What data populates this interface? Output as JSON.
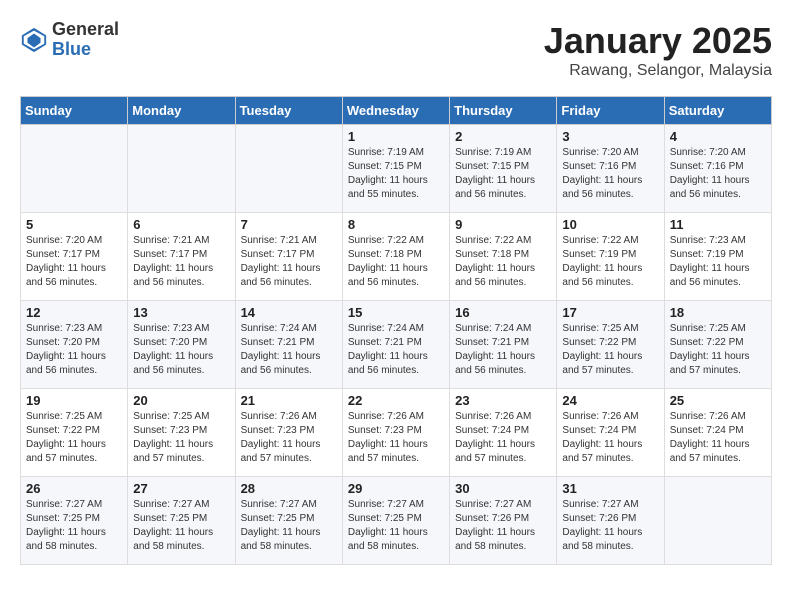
{
  "logo": {
    "general": "General",
    "blue": "Blue"
  },
  "header": {
    "month": "January 2025",
    "location": "Rawang, Selangor, Malaysia"
  },
  "weekdays": [
    "Sunday",
    "Monday",
    "Tuesday",
    "Wednesday",
    "Thursday",
    "Friday",
    "Saturday"
  ],
  "weeks": [
    [
      {
        "day": "",
        "sunrise": "",
        "sunset": "",
        "daylight": ""
      },
      {
        "day": "",
        "sunrise": "",
        "sunset": "",
        "daylight": ""
      },
      {
        "day": "",
        "sunrise": "",
        "sunset": "",
        "daylight": ""
      },
      {
        "day": "1",
        "sunrise": "Sunrise: 7:19 AM",
        "sunset": "Sunset: 7:15 PM",
        "daylight": "Daylight: 11 hours and 55 minutes."
      },
      {
        "day": "2",
        "sunrise": "Sunrise: 7:19 AM",
        "sunset": "Sunset: 7:15 PM",
        "daylight": "Daylight: 11 hours and 56 minutes."
      },
      {
        "day": "3",
        "sunrise": "Sunrise: 7:20 AM",
        "sunset": "Sunset: 7:16 PM",
        "daylight": "Daylight: 11 hours and 56 minutes."
      },
      {
        "day": "4",
        "sunrise": "Sunrise: 7:20 AM",
        "sunset": "Sunset: 7:16 PM",
        "daylight": "Daylight: 11 hours and 56 minutes."
      }
    ],
    [
      {
        "day": "5",
        "sunrise": "Sunrise: 7:20 AM",
        "sunset": "Sunset: 7:17 PM",
        "daylight": "Daylight: 11 hours and 56 minutes."
      },
      {
        "day": "6",
        "sunrise": "Sunrise: 7:21 AM",
        "sunset": "Sunset: 7:17 PM",
        "daylight": "Daylight: 11 hours and 56 minutes."
      },
      {
        "day": "7",
        "sunrise": "Sunrise: 7:21 AM",
        "sunset": "Sunset: 7:17 PM",
        "daylight": "Daylight: 11 hours and 56 minutes."
      },
      {
        "day": "8",
        "sunrise": "Sunrise: 7:22 AM",
        "sunset": "Sunset: 7:18 PM",
        "daylight": "Daylight: 11 hours and 56 minutes."
      },
      {
        "day": "9",
        "sunrise": "Sunrise: 7:22 AM",
        "sunset": "Sunset: 7:18 PM",
        "daylight": "Daylight: 11 hours and 56 minutes."
      },
      {
        "day": "10",
        "sunrise": "Sunrise: 7:22 AM",
        "sunset": "Sunset: 7:19 PM",
        "daylight": "Daylight: 11 hours and 56 minutes."
      },
      {
        "day": "11",
        "sunrise": "Sunrise: 7:23 AM",
        "sunset": "Sunset: 7:19 PM",
        "daylight": "Daylight: 11 hours and 56 minutes."
      }
    ],
    [
      {
        "day": "12",
        "sunrise": "Sunrise: 7:23 AM",
        "sunset": "Sunset: 7:20 PM",
        "daylight": "Daylight: 11 hours and 56 minutes."
      },
      {
        "day": "13",
        "sunrise": "Sunrise: 7:23 AM",
        "sunset": "Sunset: 7:20 PM",
        "daylight": "Daylight: 11 hours and 56 minutes."
      },
      {
        "day": "14",
        "sunrise": "Sunrise: 7:24 AM",
        "sunset": "Sunset: 7:21 PM",
        "daylight": "Daylight: 11 hours and 56 minutes."
      },
      {
        "day": "15",
        "sunrise": "Sunrise: 7:24 AM",
        "sunset": "Sunset: 7:21 PM",
        "daylight": "Daylight: 11 hours and 56 minutes."
      },
      {
        "day": "16",
        "sunrise": "Sunrise: 7:24 AM",
        "sunset": "Sunset: 7:21 PM",
        "daylight": "Daylight: 11 hours and 56 minutes."
      },
      {
        "day": "17",
        "sunrise": "Sunrise: 7:25 AM",
        "sunset": "Sunset: 7:22 PM",
        "daylight": "Daylight: 11 hours and 57 minutes."
      },
      {
        "day": "18",
        "sunrise": "Sunrise: 7:25 AM",
        "sunset": "Sunset: 7:22 PM",
        "daylight": "Daylight: 11 hours and 57 minutes."
      }
    ],
    [
      {
        "day": "19",
        "sunrise": "Sunrise: 7:25 AM",
        "sunset": "Sunset: 7:22 PM",
        "daylight": "Daylight: 11 hours and 57 minutes."
      },
      {
        "day": "20",
        "sunrise": "Sunrise: 7:25 AM",
        "sunset": "Sunset: 7:23 PM",
        "daylight": "Daylight: 11 hours and 57 minutes."
      },
      {
        "day": "21",
        "sunrise": "Sunrise: 7:26 AM",
        "sunset": "Sunset: 7:23 PM",
        "daylight": "Daylight: 11 hours and 57 minutes."
      },
      {
        "day": "22",
        "sunrise": "Sunrise: 7:26 AM",
        "sunset": "Sunset: 7:23 PM",
        "daylight": "Daylight: 11 hours and 57 minutes."
      },
      {
        "day": "23",
        "sunrise": "Sunrise: 7:26 AM",
        "sunset": "Sunset: 7:24 PM",
        "daylight": "Daylight: 11 hours and 57 minutes."
      },
      {
        "day": "24",
        "sunrise": "Sunrise: 7:26 AM",
        "sunset": "Sunset: 7:24 PM",
        "daylight": "Daylight: 11 hours and 57 minutes."
      },
      {
        "day": "25",
        "sunrise": "Sunrise: 7:26 AM",
        "sunset": "Sunset: 7:24 PM",
        "daylight": "Daylight: 11 hours and 57 minutes."
      }
    ],
    [
      {
        "day": "26",
        "sunrise": "Sunrise: 7:27 AM",
        "sunset": "Sunset: 7:25 PM",
        "daylight": "Daylight: 11 hours and 58 minutes."
      },
      {
        "day": "27",
        "sunrise": "Sunrise: 7:27 AM",
        "sunset": "Sunset: 7:25 PM",
        "daylight": "Daylight: 11 hours and 58 minutes."
      },
      {
        "day": "28",
        "sunrise": "Sunrise: 7:27 AM",
        "sunset": "Sunset: 7:25 PM",
        "daylight": "Daylight: 11 hours and 58 minutes."
      },
      {
        "day": "29",
        "sunrise": "Sunrise: 7:27 AM",
        "sunset": "Sunset: 7:25 PM",
        "daylight": "Daylight: 11 hours and 58 minutes."
      },
      {
        "day": "30",
        "sunrise": "Sunrise: 7:27 AM",
        "sunset": "Sunset: 7:26 PM",
        "daylight": "Daylight: 11 hours and 58 minutes."
      },
      {
        "day": "31",
        "sunrise": "Sunrise: 7:27 AM",
        "sunset": "Sunset: 7:26 PM",
        "daylight": "Daylight: 11 hours and 58 minutes."
      },
      {
        "day": "",
        "sunrise": "",
        "sunset": "",
        "daylight": ""
      }
    ]
  ]
}
